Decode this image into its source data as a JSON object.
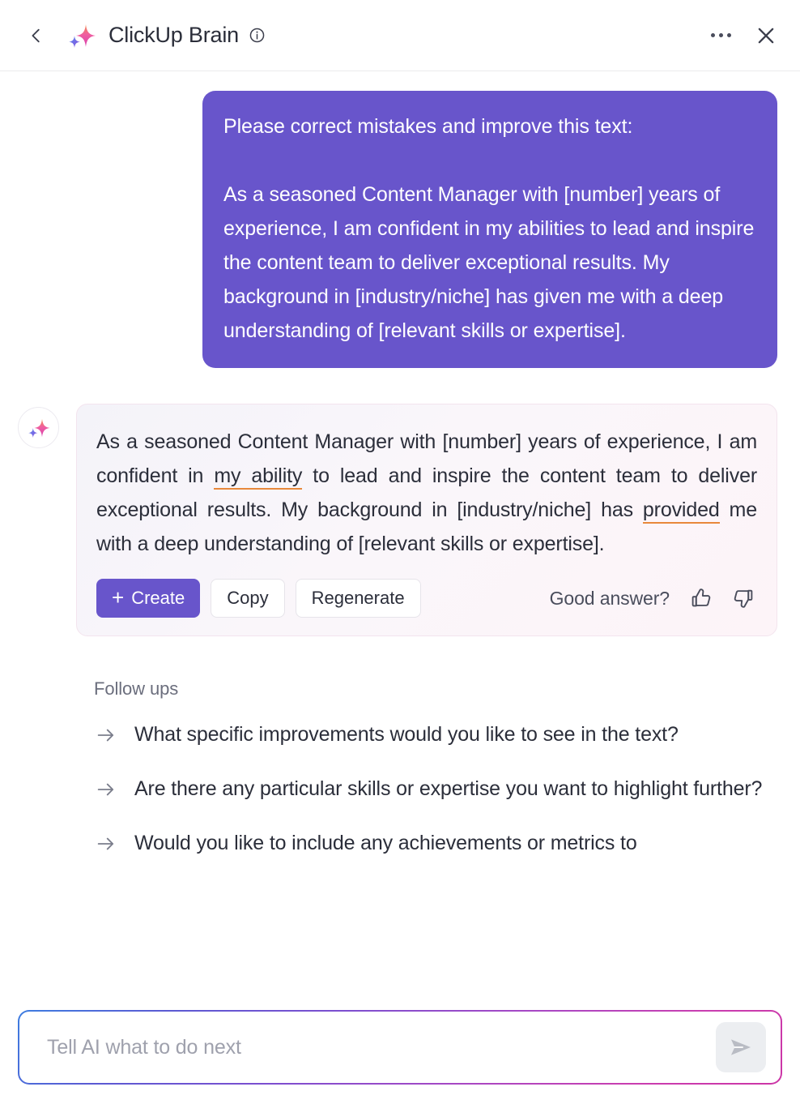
{
  "header": {
    "back_label": "Back",
    "sparkle_icon": "sparkle-icon",
    "title": "ClickUp Brain",
    "info_icon": "info-circle-icon",
    "more_icon": "ellipsis-icon",
    "close_icon": "close-icon"
  },
  "conversation": {
    "user_message": {
      "line_1": "Please correct mistakes and improve this text:",
      "line_2": "As a seasoned Content Manager with [number] years of experience, I am confident in my abilities to lead and inspire the content team to deliver exceptional results. My background in [industry/niche] has given me with a deep understanding of [relevant skills or expertise]."
    },
    "assistant_message": {
      "part_1": "As a seasoned Content Manager with [number] years of experience, I am confident in ",
      "correction_1": "my ability",
      "part_2": " to lead and inspire the content team to deliver exceptional results. My background in [industry/niche] has ",
      "correction_2": "provided",
      "part_3": " me with a deep understanding of [relevant skills or expertise]."
    },
    "actions": {
      "create_label": "Create",
      "create_plus": "+",
      "copy_label": "Copy",
      "regenerate_label": "Regenerate",
      "feedback_label": "Good answer?",
      "thumbs_up_icon": "thumbs-up-icon",
      "thumbs_down_icon": "thumbs-down-icon"
    }
  },
  "followups": {
    "title": "Follow ups",
    "items": [
      {
        "text": "What specific improvements would you like to see in the text?"
      },
      {
        "text": "Are there any particular skills or expertise you want to highlight further?"
      },
      {
        "text": "Would you like to include any achievements or metrics to"
      }
    ]
  },
  "composer": {
    "placeholder": "Tell AI what to do next",
    "value": "",
    "send_icon": "send-icon"
  },
  "colors": {
    "accent_purple": "#6855cb",
    "correction_underline": "#e8883c",
    "card_border": "#f3e4ee",
    "gradient_start": "#3d7de0",
    "gradient_end": "#cc35a6"
  }
}
